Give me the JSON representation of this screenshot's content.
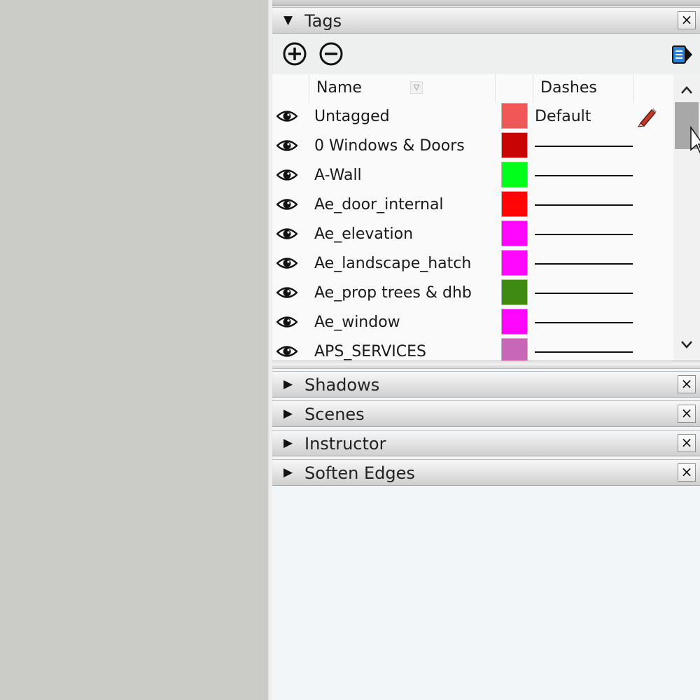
{
  "tags_panel": {
    "title": "Tags",
    "toolbar": {
      "add_icon": "plus-circle-icon",
      "remove_icon": "minus-circle-icon",
      "details_icon": "details-arrow-icon"
    },
    "columns": {
      "name": "Name",
      "dashes": "Dashes"
    },
    "rows": [
      {
        "name": "Untagged",
        "color": "#f25757",
        "dashes": "Default",
        "editable": true
      },
      {
        "name": "0 Windows & Doors",
        "color": "#c90404",
        "dashes": "",
        "editable": false
      },
      {
        "name": "A-Wall",
        "color": "#00ff1a",
        "dashes": "",
        "editable": false
      },
      {
        "name": "Ae_door_internal",
        "color": "#ff0505",
        "dashes": "",
        "editable": false
      },
      {
        "name": "Ae_elevation",
        "color": "#ff06ff",
        "dashes": "",
        "editable": false
      },
      {
        "name": "Ae_landscape_hatch",
        "color": "#ff06ff",
        "dashes": "",
        "editable": false
      },
      {
        "name": "Ae_prop trees & dhb",
        "color": "#3e8a12",
        "dashes": "",
        "editable": false
      },
      {
        "name": "Ae_window",
        "color": "#ff06ff",
        "dashes": "",
        "editable": false
      },
      {
        "name": "APS_SERVICES",
        "color": "#c866b8",
        "dashes": "",
        "editable": false
      }
    ]
  },
  "collapsed_panels": [
    {
      "title": "Shadows"
    },
    {
      "title": "Scenes"
    },
    {
      "title": "Instructor"
    },
    {
      "title": "Soften Edges"
    }
  ],
  "glyphs": {
    "expanded_arrow": "▼",
    "collapsed_arrow": "▶",
    "close": "×",
    "sort": "▽"
  }
}
